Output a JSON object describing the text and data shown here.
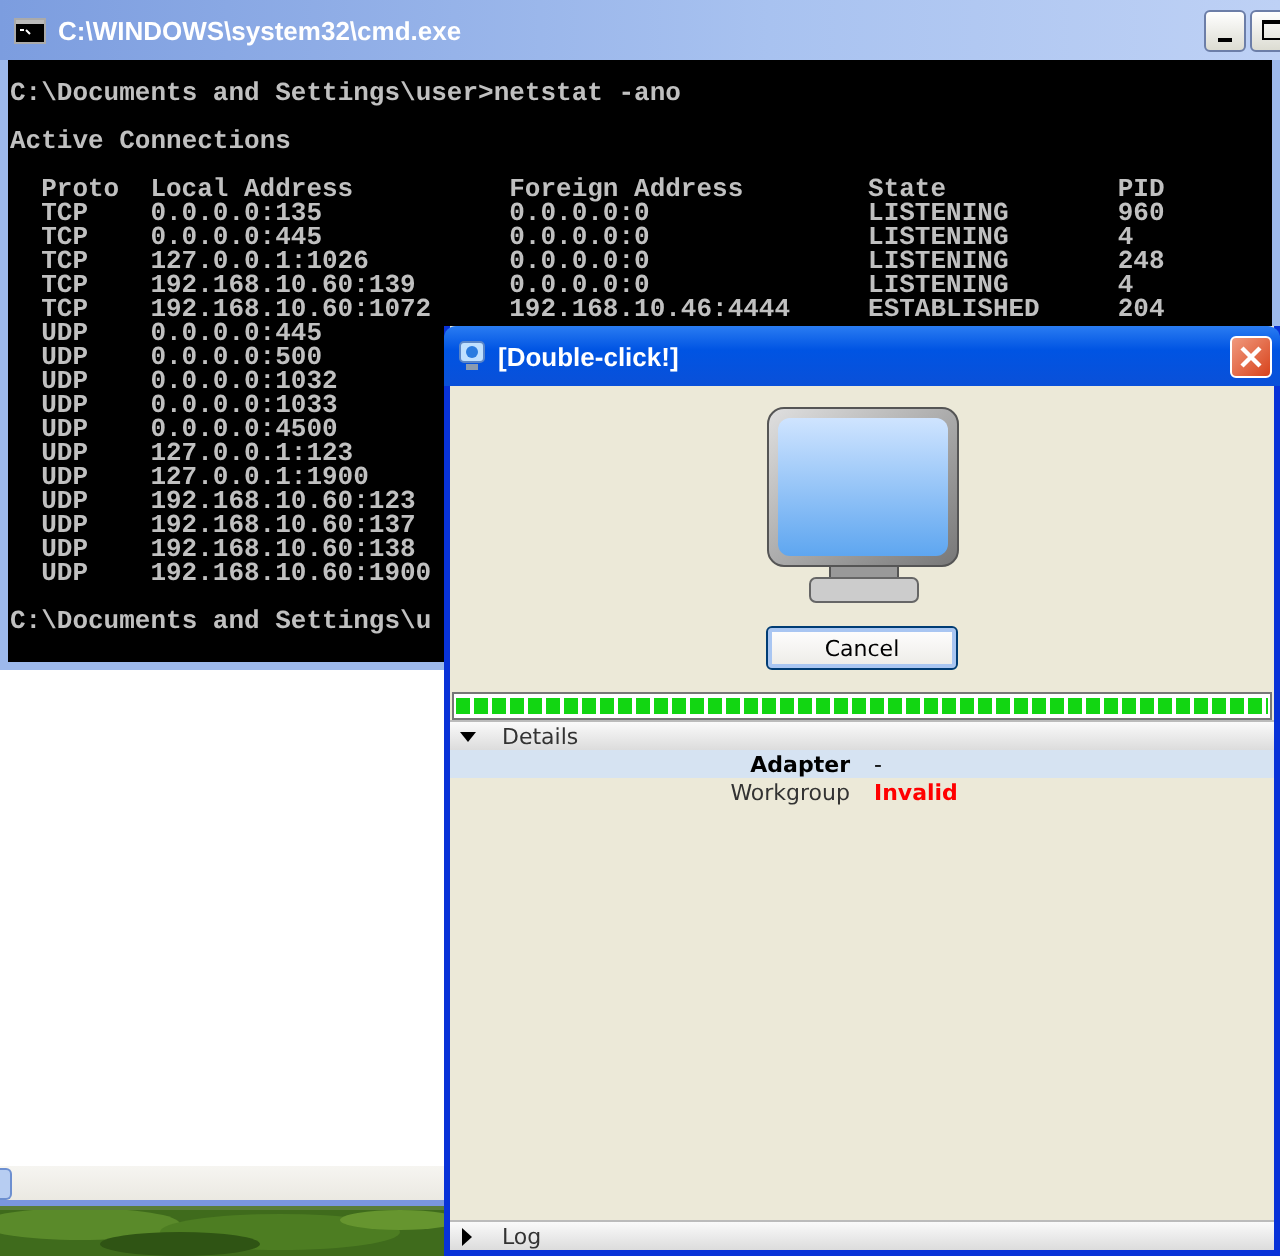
{
  "console_window": {
    "title": "C:\\WINDOWS\\system32\\cmd.exe",
    "command_line": "C:\\Documents and Settings\\user>netstat -ano",
    "heading": "Active Connections",
    "columns": [
      "Proto",
      "Local Address",
      "Foreign Address",
      "State",
      "PID"
    ],
    "rows": [
      {
        "proto": "TCP",
        "local": "0.0.0.0:135",
        "foreign": "0.0.0.0:0",
        "state": "LISTENING",
        "pid": "960"
      },
      {
        "proto": "TCP",
        "local": "0.0.0.0:445",
        "foreign": "0.0.0.0:0",
        "state": "LISTENING",
        "pid": "4"
      },
      {
        "proto": "TCP",
        "local": "127.0.0.1:1026",
        "foreign": "0.0.0.0:0",
        "state": "LISTENING",
        "pid": "248"
      },
      {
        "proto": "TCP",
        "local": "192.168.10.60:139",
        "foreign": "0.0.0.0:0",
        "state": "LISTENING",
        "pid": "4"
      },
      {
        "proto": "TCP",
        "local": "192.168.10.60:1072",
        "foreign": "192.168.10.46:4444",
        "state": "ESTABLISHED",
        "pid": "204"
      },
      {
        "proto": "UDP",
        "local": "0.0.0.0:445"
      },
      {
        "proto": "UDP",
        "local": "0.0.0.0:500"
      },
      {
        "proto": "UDP",
        "local": "0.0.0.0:1032"
      },
      {
        "proto": "UDP",
        "local": "0.0.0.0:1033"
      },
      {
        "proto": "UDP",
        "local": "0.0.0.0:4500"
      },
      {
        "proto": "UDP",
        "local": "127.0.0.1:123"
      },
      {
        "proto": "UDP",
        "local": "127.0.0.1:1900"
      },
      {
        "proto": "UDP",
        "local": "192.168.10.60:123"
      },
      {
        "proto": "UDP",
        "local": "192.168.10.60:137"
      },
      {
        "proto": "UDP",
        "local": "192.168.10.60:138"
      },
      {
        "proto": "UDP",
        "local": "192.168.10.60:1900"
      }
    ],
    "prompt_line": "C:\\Documents and Settings\\u"
  },
  "dialog": {
    "title": "[Double-click!]",
    "button": "Cancel",
    "progress": {
      "level": 1
    },
    "details": {
      "label": "Details",
      "expanded": true,
      "rows": [
        {
          "label": "Adapter",
          "value": "-",
          "selected": true,
          "kind": "normal"
        },
        {
          "label": "Workgroup",
          "value": "Invalid",
          "selected": false,
          "kind": "error"
        }
      ]
    },
    "log": {
      "label": "Log",
      "expanded": false
    }
  }
}
